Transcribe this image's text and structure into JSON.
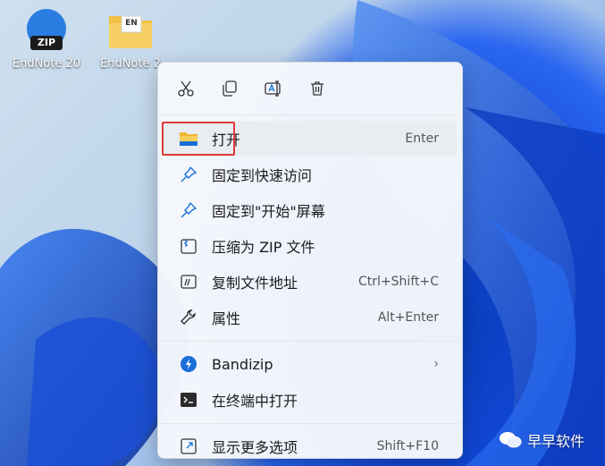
{
  "desktop": {
    "icons": [
      {
        "label": "EndNote 20",
        "icon": "zip-app-icon",
        "badge": "ZIP"
      },
      {
        "label": "EndNote 2",
        "icon": "folder-icon",
        "badge": "EN"
      }
    ]
  },
  "context_menu": {
    "toolbar": [
      {
        "name": "cut",
        "icon": "scissors-icon"
      },
      {
        "name": "copy",
        "icon": "copy-icon"
      },
      {
        "name": "rename",
        "icon": "rename-icon"
      },
      {
        "name": "delete",
        "icon": "trash-icon"
      }
    ],
    "items": [
      {
        "label": "打开",
        "shortcut": "Enter",
        "icon": "folder-icon"
      },
      {
        "label": "固定到快速访问",
        "shortcut": "",
        "icon": "pin-icon"
      },
      {
        "label": "固定到\"开始\"屏幕",
        "shortcut": "",
        "icon": "pin-icon"
      },
      {
        "label": "压缩为 ZIP 文件",
        "shortcut": "",
        "icon": "zip-file-icon"
      },
      {
        "label": "复制文件地址",
        "shortcut": "Ctrl+Shift+C",
        "icon": "path-icon"
      },
      {
        "label": "属性",
        "shortcut": "Alt+Enter",
        "icon": "wrench-icon"
      },
      {
        "label": "Bandizip",
        "shortcut": "",
        "icon": "bandizip-icon"
      },
      {
        "label": "在终端中打开",
        "shortcut": "",
        "icon": "terminal-icon"
      },
      {
        "label": "显示更多选项",
        "shortcut": "Shift+F10",
        "icon": "more-options-icon"
      }
    ]
  },
  "watermark": {
    "text": "早早软件",
    "icon": "wechat-icon"
  },
  "colors": {
    "accent": "#1a6fd8",
    "highlight_box": "#e23a3a"
  }
}
